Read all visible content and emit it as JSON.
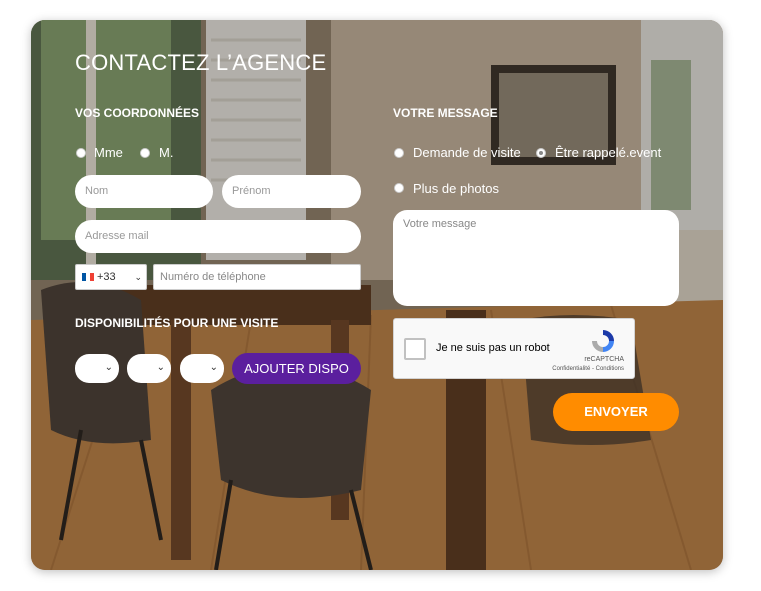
{
  "form": {
    "title": "CONTACTEZ L’AGENCE",
    "coords_heading": "VOS COORDONNÉES",
    "civility_options": [
      "Mme",
      "M."
    ],
    "nom_placeholder": "Nom",
    "prenom_placeholder": "Prénom",
    "email_placeholder": "Adresse mail",
    "phone_country_code": "+33",
    "phone_placeholder": "Numéro de téléphone",
    "availability_heading": "DISPONIBILITÉS POUR UNE VISITE",
    "add_availability_label": "AJOUTER DISPO",
    "message_heading": "VOTRE MESSAGE",
    "message_options": [
      "Demande de visite",
      "Être rappelé.event",
      "Plus de photos"
    ],
    "message_placeholder": "Votre message",
    "captcha_label": "Je ne suis pas un robot",
    "captcha_brand": "reCAPTCHA",
    "captcha_links": "Confidentialité - Conditions",
    "submit_label": "ENVOYER"
  },
  "colors": {
    "accent_purple": "#5b1f9e",
    "accent_orange": "#ff8c00"
  },
  "icons": [
    "flag-france-icon",
    "chevron-down-icon",
    "recaptcha-logo-icon"
  ]
}
